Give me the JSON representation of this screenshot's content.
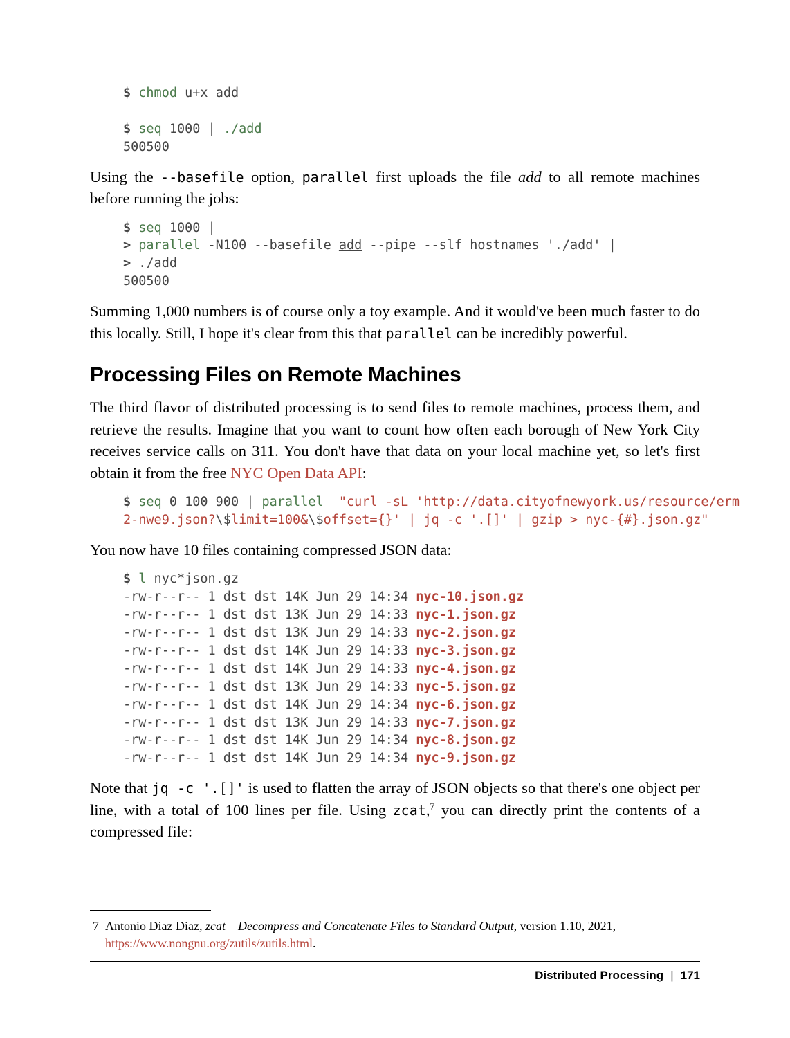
{
  "code1": {
    "l1_prompt": "$",
    "l1_cmd": "chmod",
    "l1_rest": " u+x ",
    "l1_underlined": "add",
    "l2_prompt": "$",
    "l2_cmd": "seq",
    "l2_rest": " 1000 | ",
    "l2_add": "./add",
    "l3": "500500"
  },
  "para1_a": "Using the ",
  "para1_b": "--basefile",
  "para1_c": " option, ",
  "para1_d": "parallel",
  "para1_e": " first uploads the file ",
  "para1_f": "add",
  "para1_g": " to all remote machines before running the jobs:",
  "code2": {
    "l1_prompt": "$",
    "l1_cmd": "seq",
    "l1_rest": " 1000 |",
    "l2_prompt": ">",
    "l2_cmd": "parallel",
    "l2_rest_a": " -N100 --basefile ",
    "l2_under": "add",
    "l2_rest_b": " --pipe --slf hostnames './add' |",
    "l3_prompt": ">",
    "l3_rest": " ./add",
    "l4": "500500"
  },
  "para2_a": "Summing 1,000 numbers is of course only a toy example. And it would've been much faster to do this locally. Still, I hope it's clear from this that ",
  "para2_b": "parallel",
  "para2_c": " can be incredibly powerful.",
  "heading": "Processing Files on Remote Machines",
  "para3_a": "The third flavor of distributed processing is to send files to remote machines, process them, and retrieve the results. Imagine that you want to count how often each borough of New York City receives service calls on 311. You don't have that data on your local machine yet, so let's first obtain it from the free ",
  "para3_link": "NYC Open Data API",
  "para3_b": ":",
  "code3": {
    "l1_prompt": "$",
    "l1_cmd1": "seq",
    "l1_mid": " 0 100 900 | ",
    "l1_cmd2": "parallel",
    "l1_space": "  ",
    "l1_str_a": "\"curl -sL 'http://data.cityofnewyork.us/resource/erm",
    "l2_str": "2-nwe9.json?",
    "l2_esc1": "\\$",
    "l2_str_b": "limit=100&",
    "l2_esc2": "\\$",
    "l2_str_c": "offset={}' | jq -c '.[]' | gzip > nyc-{#}.json.gz\""
  },
  "para4": "You now have 10 files containing compressed JSON data:",
  "code4": {
    "l1_prompt": "$",
    "l1_cmd": "l",
    "l1_rest": " nyc*json.gz",
    "rows": [
      {
        "meta": "-rw-r--r-- 1 dst dst 14K Jun 29 14:34 ",
        "file": "nyc-10.json.gz"
      },
      {
        "meta": "-rw-r--r-- 1 dst dst 13K Jun 29 14:33 ",
        "file": "nyc-1.json.gz"
      },
      {
        "meta": "-rw-r--r-- 1 dst dst 13K Jun 29 14:33 ",
        "file": "nyc-2.json.gz"
      },
      {
        "meta": "-rw-r--r-- 1 dst dst 14K Jun 29 14:33 ",
        "file": "nyc-3.json.gz"
      },
      {
        "meta": "-rw-r--r-- 1 dst dst 14K Jun 29 14:33 ",
        "file": "nyc-4.json.gz"
      },
      {
        "meta": "-rw-r--r-- 1 dst dst 13K Jun 29 14:33 ",
        "file": "nyc-5.json.gz"
      },
      {
        "meta": "-rw-r--r-- 1 dst dst 14K Jun 29 14:34 ",
        "file": "nyc-6.json.gz"
      },
      {
        "meta": "-rw-r--r-- 1 dst dst 13K Jun 29 14:33 ",
        "file": "nyc-7.json.gz"
      },
      {
        "meta": "-rw-r--r-- 1 dst dst 14K Jun 29 14:34 ",
        "file": "nyc-8.json.gz"
      },
      {
        "meta": "-rw-r--r-- 1 dst dst 14K Jun 29 14:34 ",
        "file": "nyc-9.json.gz"
      }
    ]
  },
  "para5_a": "Note that ",
  "para5_b": "jq -c '.[]'",
  "para5_c": " is used to flatten the array of JSON objects so that there's one object per line, with a total of 100 lines per file. Using ",
  "para5_d": "zcat",
  "para5_e": ",",
  "para5_sup": "7",
  "para5_f": " you can directly print the contents of a compressed file:",
  "footnote": {
    "num": "7",
    "a": "Antonio Diaz Diaz, ",
    "title": "zcat – Decompress and Concatenate Files to Standard Output",
    "b": ", version 1.10, 2021, ",
    "link": "https://www.nongnu.org/zutils/zutils.html",
    "c": "."
  },
  "footer": {
    "section": "Distributed Processing",
    "sep": "|",
    "page": "171"
  }
}
